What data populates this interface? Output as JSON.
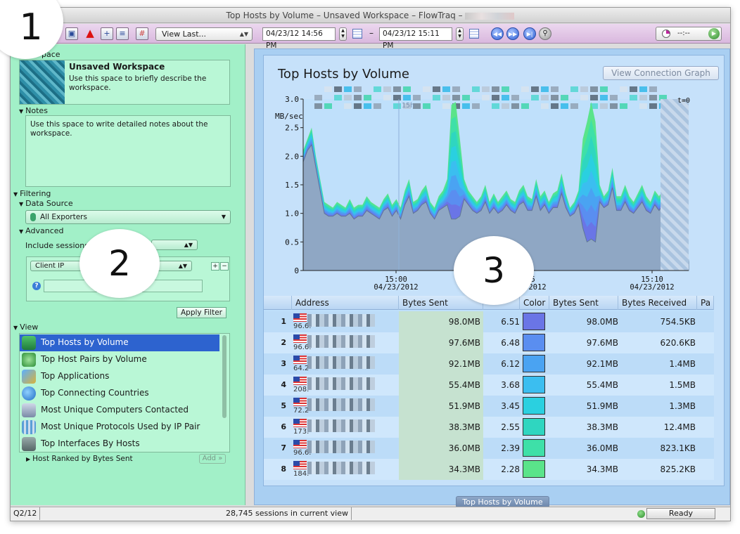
{
  "window": {
    "title": "Top Hosts by Volume – Unsaved Workspace – FlowTraq –"
  },
  "toolbar": {
    "view_last": "View Last...",
    "start_time": "04/23/12 14:56 PM",
    "end_time": "04/23/12 15:11 PM",
    "dash": "–",
    "timer": "--:--"
  },
  "workspace": {
    "section_label": "pace",
    "title": "Unsaved Workspace",
    "description": "Use this space to briefly describe the workspace."
  },
  "notes": {
    "label": "Notes",
    "text": "Use this space to write detailed notes about the workspace."
  },
  "filtering": {
    "label": "Filtering",
    "data_source_label": "Data Source",
    "data_source_value": "All Exporters",
    "advanced_label": "Advanced",
    "include_sessions_label": "Include sessions",
    "client_ip_label": "Client IP",
    "apply_button": "Apply Filter"
  },
  "view": {
    "label": "View",
    "items": [
      {
        "label": "Top Hosts by Volume",
        "selected": true,
        "icon": "hosts-icon"
      },
      {
        "label": "Top Host Pairs by Volume",
        "selected": false,
        "icon": "host-pairs-icon"
      },
      {
        "label": "Top Applications",
        "selected": false,
        "icon": "applications-icon"
      },
      {
        "label": "Top Connecting Countries",
        "selected": false,
        "icon": "globe-icon"
      },
      {
        "label": "Most Unique Computers Contacted",
        "selected": false,
        "icon": "network-icon"
      },
      {
        "label": "Most Unique Protocols Used by IP Pair",
        "selected": false,
        "icon": "protocols-icon"
      },
      {
        "label": "Top Interfaces By Hosts",
        "selected": false,
        "icon": "interfaces-icon"
      }
    ],
    "ranked_label": "Host Ranked by Bytes Sent",
    "add_button": "Add »"
  },
  "main": {
    "title": "Top Hosts by Volume",
    "connection_graph_button": "View Connection Graph",
    "bottom_tab": "Top Hosts by Volume"
  },
  "chart_data": {
    "type": "area",
    "ylabel": "MB/sec",
    "ylim": [
      0,
      3.0
    ],
    "y_ticks": [
      "0",
      "0.5",
      "1.0",
      "1.5",
      "2.0",
      "2.5",
      "3.0"
    ],
    "x_ticks": [
      {
        "time": "15:00",
        "date": "04/23/2012"
      },
      {
        "time": "15:05",
        "date": "04/23/2012"
      },
      {
        "time": "15:10",
        "date": "04/23/2012"
      }
    ],
    "marker_label": "15h",
    "t_label": "t=0",
    "colors": [
      "#6a75e6",
      "#5a8ef0",
      "#4aa3f2",
      "#3bbef0",
      "#2ad0e0",
      "#2fd6c0",
      "#3ee0a8",
      "#5ae48a"
    ],
    "total": [
      2.1,
      2.3,
      2.5,
      2.0,
      1.6,
      1.2,
      1.15,
      1.1,
      1.2,
      1.15,
      1.1,
      1.25,
      1.1,
      1.15,
      1.15,
      1.3,
      1.2,
      1.15,
      1.1,
      1.25,
      1.35,
      1.15,
      1.25,
      1.1,
      1.4,
      1.6,
      1.2,
      1.25,
      1.4,
      1.5,
      1.2,
      1.1,
      1.3,
      1.4,
      1.6,
      2.9,
      2.95,
      2.3,
      1.6,
      1.4,
      1.3,
      1.2,
      1.3,
      1.5,
      1.2,
      1.35,
      1.2,
      1.3,
      1.4,
      1.25,
      1.2,
      1.4,
      1.5,
      1.3,
      1.25,
      1.6,
      1.3,
      1.4,
      1.2,
      1.35,
      1.4,
      1.7,
      1.35,
      1.1,
      1.2,
      1.4,
      2.3,
      2.6,
      2.95,
      2.6,
      1.5,
      1.3,
      1.4,
      1.8,
      1.3,
      1.3,
      1.5,
      1.3,
      1.2,
      1.35,
      1.5,
      1.3,
      1.2,
      1.4,
      1.3,
      1.4,
      1.3,
      1.4,
      1.2,
      1.1,
      1.0,
      0.2
    ],
    "base": [
      1.9,
      2.1,
      2.2,
      1.8,
      1.4,
      1.0,
      0.95,
      0.95,
      1.0,
      0.95,
      0.95,
      1.0,
      0.9,
      0.95,
      0.95,
      1.05,
      1.0,
      0.95,
      0.9,
      1.05,
      1.1,
      0.95,
      1.05,
      0.9,
      1.15,
      1.3,
      1.0,
      1.05,
      1.15,
      1.2,
      1.0,
      0.9,
      1.05,
      1.1,
      1.15,
      0.9,
      0.9,
      0.95,
      1.25,
      1.15,
      1.05,
      1.0,
      1.05,
      1.2,
      1.0,
      1.1,
      1.0,
      1.05,
      1.15,
      1.05,
      1.0,
      1.15,
      1.2,
      1.05,
      1.05,
      1.3,
      1.05,
      1.15,
      1.0,
      1.1,
      1.1,
      1.35,
      1.1,
      0.95,
      1.0,
      1.15,
      0.75,
      0.5,
      0.55,
      0.5,
      1.2,
      1.1,
      1.15,
      1.45,
      1.05,
      1.05,
      1.2,
      1.05,
      1.0,
      1.1,
      1.2,
      1.05,
      1.0,
      1.15,
      1.05,
      1.15,
      1.05,
      1.15,
      1.0,
      0.9,
      0.85,
      0.15
    ]
  },
  "table": {
    "columns": [
      "Address",
      "Bytes Sent",
      "",
      "Color",
      "Bytes Sent",
      "Bytes Received",
      "Pa"
    ],
    "rows": [
      {
        "rank": "1",
        "ip": "96.6.",
        "bytes_sent": "98.0MB",
        "pct": "6.51",
        "color": "#6a75e6",
        "bytes_sent2": "98.0MB",
        "bytes_received": "754.5KB"
      },
      {
        "rank": "2",
        "ip": "96.6.",
        "bytes_sent": "97.6MB",
        "pct": "6.48",
        "color": "#5a8ef0",
        "bytes_sent2": "97.6MB",
        "bytes_received": "620.6KB"
      },
      {
        "rank": "3",
        "ip": "64.2",
        "bytes_sent": "92.1MB",
        "pct": "6.12",
        "color": "#4aa3f2",
        "bytes_sent2": "92.1MB",
        "bytes_received": "1.4MB"
      },
      {
        "rank": "4",
        "ip": "208.",
        "bytes_sent": "55.4MB",
        "pct": "3.68",
        "color": "#3bbef0",
        "bytes_sent2": "55.4MB",
        "bytes_received": "1.5MB"
      },
      {
        "rank": "5",
        "ip": "72.2",
        "bytes_sent": "51.9MB",
        "pct": "3.45",
        "color": "#2ad0e0",
        "bytes_sent2": "51.9MB",
        "bytes_received": "1.3MB"
      },
      {
        "rank": "6",
        "ip": "173.",
        "bytes_sent": "38.3MB",
        "pct": "2.55",
        "color": "#2fd6c0",
        "bytes_sent2": "38.3MB",
        "bytes_received": "12.4MB"
      },
      {
        "rank": "7",
        "ip": "96.6.",
        "bytes_sent": "36.0MB",
        "pct": "2.39",
        "color": "#3ee0a8",
        "bytes_sent2": "36.0MB",
        "bytes_received": "823.1KB"
      },
      {
        "rank": "8",
        "ip": "184.",
        "bytes_sent": "34.3MB",
        "pct": "2.28",
        "color": "#5ae48a",
        "bytes_sent2": "34.3MB",
        "bytes_received": "825.2KB"
      }
    ]
  },
  "status": {
    "date": "Q2/12",
    "sessions": "28,745 sessions in current view",
    "ready": "Ready"
  },
  "callouts": [
    "1",
    "2",
    "3"
  ]
}
